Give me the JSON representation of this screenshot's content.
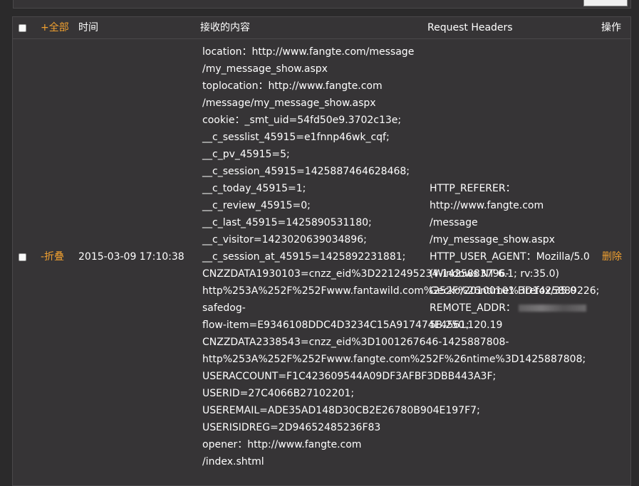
{
  "header": {
    "expand_all": "+全部",
    "time": "时间",
    "content": "接收的内容",
    "request_headers": "Request Headers",
    "actions": "操作"
  },
  "row": {
    "collapse": "-折叠",
    "time": "2015-03-09 17:10:38",
    "content_lines": [
      "location：http://www.fangte.com/message",
      "/my_message_show.aspx",
      "toplocation：http://www.fangte.com",
      "/message/my_message_show.aspx",
      "cookie：_smt_uid=54fd50e9.3702c13e;",
      "__c_sesslist_45915=e1fnnp46wk_cqf;",
      "__c_pv_45915=5;",
      "__c_session_45915=1425887464628468;",
      "__c_today_45915=1;",
      "__c_review_45915=0;",
      "__c_last_45915=1425890531180;",
      "__c_visitor=1423020639034896;",
      "__c_session_at_45915=1425892231881;",
      "CNZZDATA1930103=cnzz_eid%3D2212495234-1425883796-",
      "http%253A%252F%252Fwww.fantawild.com%252F%26ntime%3D1425889226;",
      "safedog-",
      "flow-item=E9346108DDC4D3234C15A917474E4561;",
      "CNZZDATA2338543=cnzz_eid%3D1001267646-1425887808-",
      "http%253A%252F%252Fwww.fangte.com%252F%26ntime%3D1425887808;",
      "USERACCOUNT=F1C423609544A09DF3AFBF3DBB443A3F;",
      "USERID=27C4066B27102201;",
      "USEREMAIL=ADE35AD148D30CB2E26780B904E197F7;",
      "USERISIDREG=2D94652485236F83",
      "opener：http://www.fangte.com",
      "/index.shtml"
    ],
    "headers_lines": [
      "HTTP_REFERER：",
      "http://www.fangte.com",
      "/message",
      "/my_message_show.aspx",
      "HTTP_USER_AGENT：Mozilla/5.0",
      "(Windows NT 6.1; rv:35.0)",
      "Gecko/20100101 Firefox/35.0",
      "REMOTE_ADDR：",
      "58.250.120.19"
    ],
    "delete": "删除"
  }
}
